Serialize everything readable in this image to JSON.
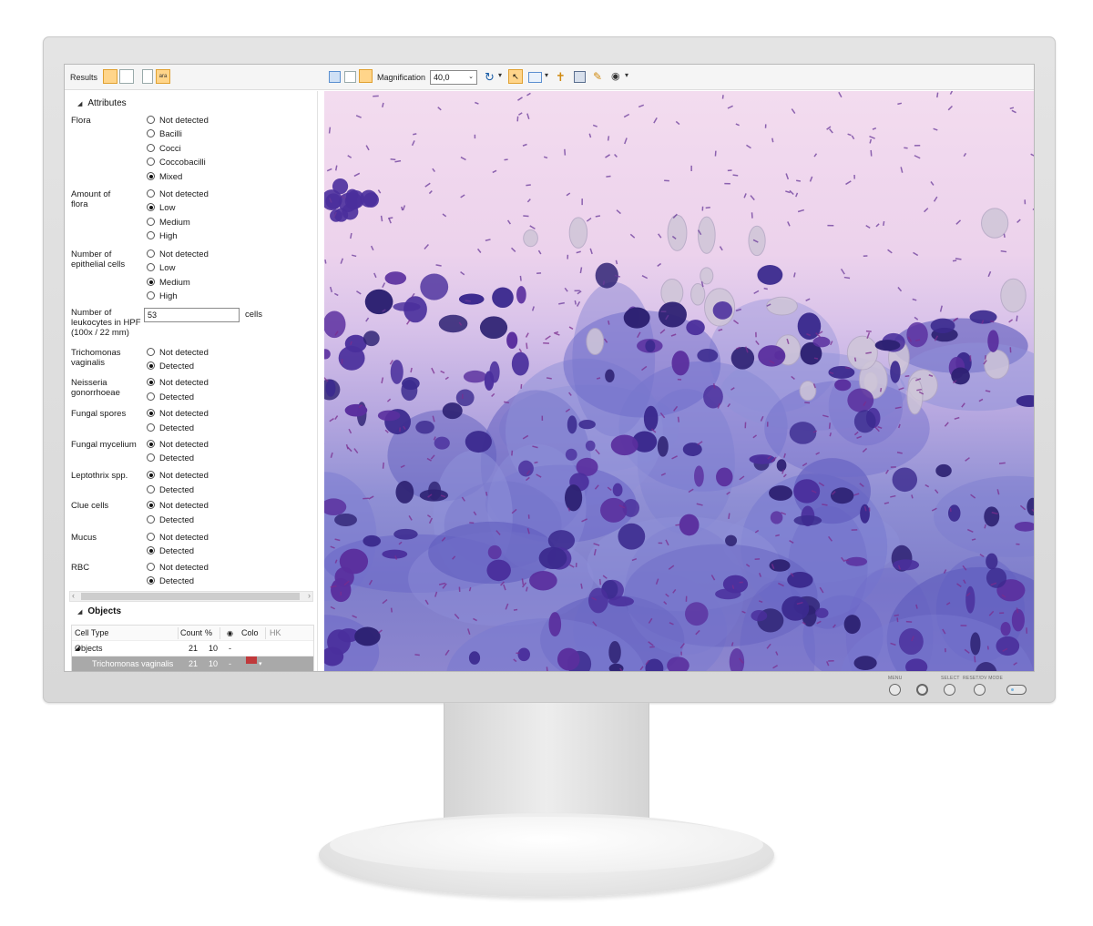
{
  "monitor": {
    "buttons": [
      "MENU",
      "SELECT",
      "RESET/DV MODE"
    ]
  },
  "toolbar": {
    "results_label": "Results",
    "ara_label": "ara",
    "magnification_label": "Magnification",
    "magnification_value": "40,0"
  },
  "attributes": {
    "title": "Attributes",
    "groups": [
      {
        "label": "Flora",
        "options": [
          "Not detected",
          "Bacilli",
          "Cocci",
          "Coccobacilli",
          "Mixed"
        ],
        "selected": "Mixed"
      },
      {
        "label": "Amount of flora",
        "options": [
          "Not detected",
          "Low",
          "Medium",
          "High"
        ],
        "selected": "Low"
      },
      {
        "label": "Number of epithelial cells",
        "options": [
          "Not detected",
          "Low",
          "Medium",
          "High"
        ],
        "selected": "Medium"
      },
      {
        "label": "Trichomonas vaginalis",
        "options": [
          "Not detected",
          "Detected"
        ],
        "selected": "Detected"
      },
      {
        "label": "Neisseria gonorrhoeae",
        "options": [
          "Not detected",
          "Detected"
        ],
        "selected": "Not detected"
      },
      {
        "label": "Fungal spores",
        "options": [
          "Not detected",
          "Detected"
        ],
        "selected": "Not detected"
      },
      {
        "label": "Fungal mycelium",
        "options": [
          "Not detected",
          "Detected"
        ],
        "selected": "Not detected"
      },
      {
        "label": "Leptothrix spp.",
        "options": [
          "Not detected",
          "Detected"
        ],
        "selected": "Not detected"
      },
      {
        "label": "Clue cells",
        "options": [
          "Not detected",
          "Detected"
        ],
        "selected": "Not detected"
      },
      {
        "label": "Mucus",
        "options": [
          "Not detected",
          "Detected"
        ],
        "selected": "Detected"
      },
      {
        "label": "RBC",
        "options": [
          "Not detected",
          "Detected"
        ],
        "selected": "Detected"
      }
    ],
    "leukocytes": {
      "label": "Number of leukocytes in HPF (100x / 22 mm)",
      "value": "53",
      "unit": "cells"
    }
  },
  "objects": {
    "title": "Objects",
    "columns": [
      "Cell Type",
      "Count",
      "%",
      "Colo",
      "HK"
    ],
    "rows": [
      {
        "name": "Objects",
        "count": "21",
        "percent": "10",
        "extra": "-"
      },
      {
        "name": "Trichomonas vaginalis",
        "count": "21",
        "percent": "10",
        "extra": "-"
      }
    ],
    "swatch_color": "#c0393b"
  }
}
